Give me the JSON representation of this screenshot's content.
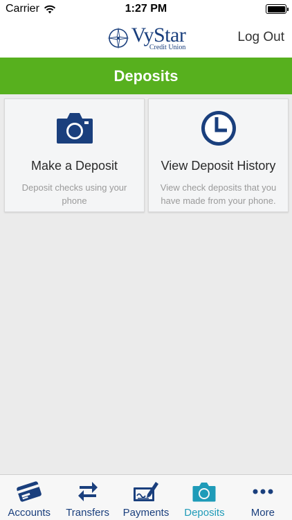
{
  "status_bar": {
    "carrier": "Carrier",
    "time": "1:27 PM"
  },
  "nav": {
    "logo_name": "VyStar",
    "logo_sub": "Credit Union",
    "logout_label": "Log Out"
  },
  "page": {
    "title": "Deposits"
  },
  "tiles": [
    {
      "title": "Make a Deposit",
      "description": "Deposit checks using your phone",
      "icon": "camera-icon"
    },
    {
      "title": "View Deposit History",
      "description": "View check deposits that you have made from your phone.",
      "icon": "clock-icon"
    }
  ],
  "tab_bar": {
    "active": "Deposits",
    "items": [
      {
        "label": "Accounts",
        "icon": "credit-card-icon"
      },
      {
        "label": "Transfers",
        "icon": "transfer-arrows-icon"
      },
      {
        "label": "Payments",
        "icon": "check-pen-icon"
      },
      {
        "label": "Deposits",
        "icon": "camera-icon"
      },
      {
        "label": "More",
        "icon": "more-dots-icon"
      }
    ]
  },
  "colors": {
    "brand_blue": "#1a3f7d",
    "header_green": "#57b01e",
    "active_tab": "#1f9bb8"
  }
}
